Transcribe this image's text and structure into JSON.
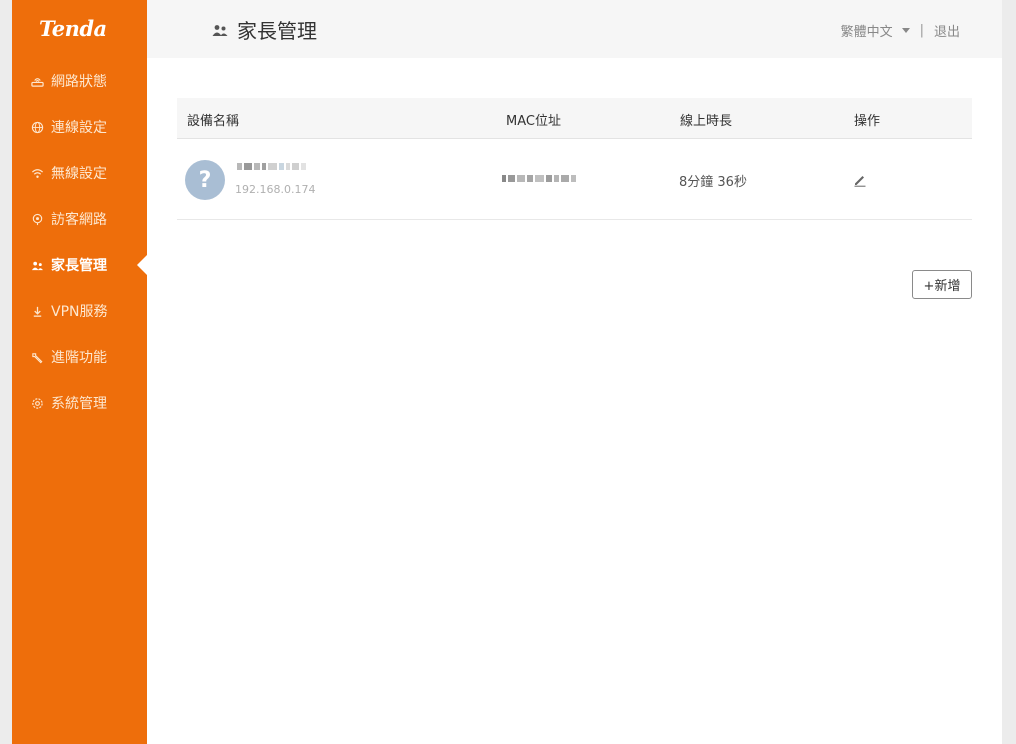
{
  "brand": {
    "logo_text": "Tenda",
    "accent_color": "#ee6e0b"
  },
  "sidebar": {
    "items": [
      {
        "label": "網路狀態",
        "icon": "router-icon",
        "active": false
      },
      {
        "label": "連線設定",
        "icon": "globe-icon",
        "active": false
      },
      {
        "label": "無線設定",
        "icon": "wifi-icon",
        "active": false
      },
      {
        "label": "訪客網路",
        "icon": "guest-network-icon",
        "active": false
      },
      {
        "label": "家長管理",
        "icon": "parental-icon",
        "active": true
      },
      {
        "label": "VPN服務",
        "icon": "vpn-icon",
        "active": false
      },
      {
        "label": "進階功能",
        "icon": "wrench-icon",
        "active": false
      },
      {
        "label": "系統管理",
        "icon": "gear-icon",
        "active": false
      }
    ]
  },
  "header": {
    "title": "家長管理",
    "language": "繁體中文",
    "divider": "|",
    "logout": "退出"
  },
  "table": {
    "columns": [
      "設備名稱",
      "MAC位址",
      "線上時長",
      "操作"
    ],
    "rows": [
      {
        "avatar_symbol": "?",
        "ip": "192.168.0.174",
        "online_time": "8分鐘 36秒"
      }
    ]
  },
  "actions": {
    "add_label": "+新增"
  }
}
